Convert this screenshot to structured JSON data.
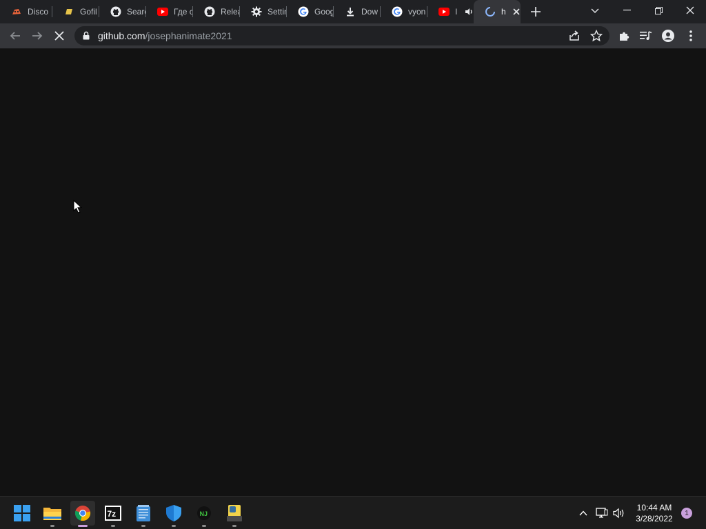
{
  "browser": {
    "tabs": [
      {
        "title": "Disco",
        "icon": "discord-like-icon"
      },
      {
        "title": "Gofil",
        "icon": "gofile-icon"
      },
      {
        "title": "Searc",
        "icon": "github-icon"
      },
      {
        "title": "Где с",
        "icon": "youtube-icon"
      },
      {
        "title": "Relea",
        "icon": "github-icon"
      },
      {
        "title": "Settin",
        "icon": "gear-icon"
      },
      {
        "title": "Goog",
        "icon": "google-icon"
      },
      {
        "title": "Dow",
        "icon": "download-icon"
      },
      {
        "title": "vyon",
        "icon": "google-icon"
      },
      {
        "title": "I",
        "icon": "youtube-icon"
      },
      {
        "title": "h",
        "icon": "loading-spinner-icon",
        "active": true
      }
    ],
    "address": {
      "host": "github.com",
      "path": "/josephanimate2021"
    }
  },
  "taskbar": {
    "apps": [
      "start-icon",
      "file-explorer-icon",
      "chrome-icon",
      "7zip-icon",
      "notepad-icon",
      "windows-security-icon",
      "node-icon",
      "python-icon"
    ],
    "clock": {
      "time": "10:44 AM",
      "date": "3/28/2022"
    },
    "notification_count": "1"
  },
  "colors": {
    "accent": "#c9a0dc",
    "background": "#121212",
    "tabstrip": "#202124",
    "toolbar": "#35363a"
  }
}
